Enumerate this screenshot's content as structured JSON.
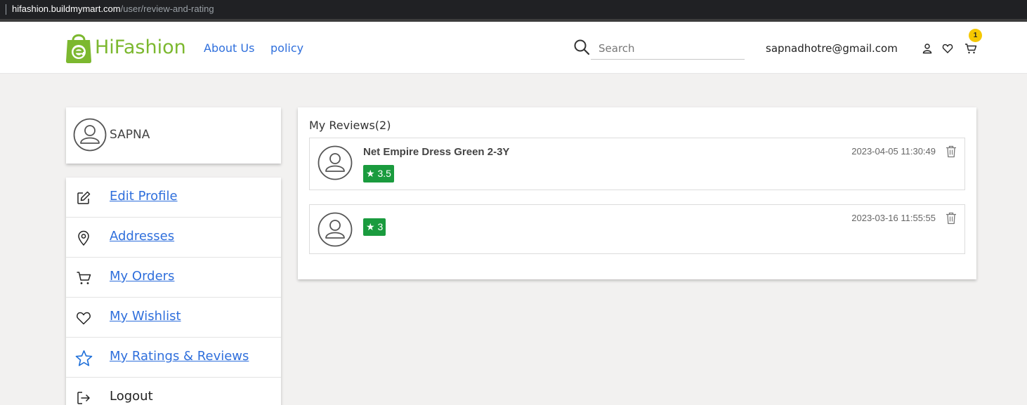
{
  "browser": {
    "url_host": "hifashion.buildmymart.com",
    "url_path": "/user/review-and-rating"
  },
  "header": {
    "brand": "HiFashion",
    "nav": [
      "About Us",
      "policy"
    ],
    "search_placeholder": "Search",
    "email": "sapnadhotre@gmail.com",
    "cart_count": "1"
  },
  "sidebar": {
    "user_name": "SAPNA",
    "items": [
      {
        "label": "Edit Profile",
        "icon": "edit-icon"
      },
      {
        "label": "Addresses",
        "icon": "location-pin-icon"
      },
      {
        "label": "My Orders",
        "icon": "cart-icon"
      },
      {
        "label": "My Wishlist",
        "icon": "heart-icon"
      },
      {
        "label": "My Ratings & Reviews",
        "icon": "star-icon"
      },
      {
        "label": "Logout",
        "icon": "logout-icon"
      }
    ]
  },
  "reviews": {
    "title": "My Reviews(2)",
    "items": [
      {
        "product": "Net Empire Dress Green 2-3Y",
        "rating": "★ 3.5",
        "date": "2023-04-05 11:30:49"
      },
      {
        "product": "",
        "rating": "★ 3",
        "date": "2023-03-16 11:55:55"
      }
    ]
  },
  "colors": {
    "brand_green": "#7cb82f",
    "link_blue": "#2f6fdc",
    "rating_green": "#1a9b3e",
    "badge_yellow": "#f5c800",
    "active_star_blue": "#1e6fd9"
  }
}
